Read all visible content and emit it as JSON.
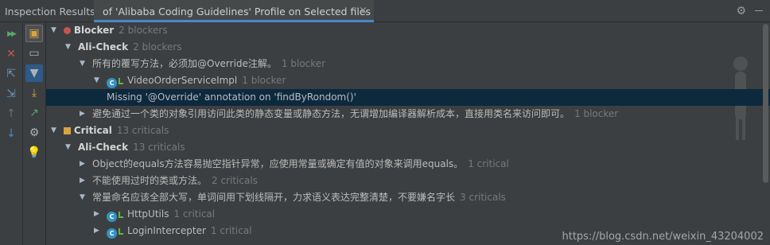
{
  "header": {
    "title": "Inspection Results:",
    "tab_label": "of 'Alibaba Coding Guidelines' Profile on Selected files",
    "close_glyph": "×"
  },
  "toolbar_left": [
    {
      "name": "rerun-icon",
      "glyph": "▶▶",
      "color": "#59a869"
    },
    {
      "name": "close-icon",
      "glyph": "✕",
      "color": "#c75450"
    },
    {
      "name": "expand-all-icon",
      "glyph": "⇱",
      "color": "#6897bb"
    },
    {
      "name": "collapse-all-icon",
      "glyph": "⇲",
      "color": "#6897bb"
    },
    {
      "name": "previous-icon",
      "glyph": "↑",
      "color": "#6e6e6e"
    },
    {
      "name": "next-icon",
      "glyph": "↓",
      "color": "#4a88c7"
    }
  ],
  "toolbar_right": [
    {
      "name": "group-by-severity-icon",
      "glyph": "▣",
      "color": "#d9a343"
    },
    {
      "name": "group-by-directory-icon",
      "glyph": "▭",
      "color": "#afb1b3"
    },
    {
      "name": "filter-icon",
      "glyph": "▼",
      "color": "#afb1b3"
    },
    {
      "name": "export-icon",
      "glyph": "⤓",
      "color": "#d9a343"
    },
    {
      "name": "edit-settings-icon",
      "glyph": "↗",
      "color": "#59a869"
    },
    {
      "name": "quickfix-icon",
      "glyph": "⚙",
      "color": "#afb1b3"
    },
    {
      "name": "lightbulb-icon",
      "glyph": "💡",
      "color": "#e8c046"
    }
  ],
  "tree": [
    {
      "level": 0,
      "arrow": "▼",
      "icon": "blocker",
      "label": "Blocker",
      "bold": true,
      "count": "2 blockers"
    },
    {
      "level": 1,
      "arrow": "▼",
      "icon": "",
      "label": "Ali-Check",
      "bold": true,
      "count": "2 blockers"
    },
    {
      "level": 2,
      "arrow": "▼",
      "icon": "",
      "label": "所有的覆写方法，必须加@Override注解。",
      "bold": false,
      "count": "1 blocker"
    },
    {
      "level": 3,
      "arrow": "▼",
      "icon": "class",
      "label": "VideoOrderServiceImpl",
      "bold": false,
      "count": "1 blocker"
    },
    {
      "level": 4,
      "arrow": "",
      "icon": "",
      "label": "Missing '@Override' annotation on 'findByRondom()'",
      "bold": false,
      "count": "",
      "selected": true
    },
    {
      "level": 2,
      "arrow": "▶",
      "icon": "",
      "label": "避免通过一个类的对象引用访问此类的静态变量或静态方法，无谓增加编译器解析成本，直接用类名来访问即可。",
      "bold": false,
      "count": "1 blocker"
    },
    {
      "level": 0,
      "arrow": "▼",
      "icon": "critical",
      "label": "Critical",
      "bold": true,
      "count": "13 criticals"
    },
    {
      "level": 1,
      "arrow": "▼",
      "icon": "",
      "label": "Ali-Check",
      "bold": true,
      "count": "13 criticals"
    },
    {
      "level": 2,
      "arrow": "▶",
      "icon": "",
      "label": "Object的equals方法容易抛空指针异常，应使用常量或确定有值的对象来调用equals。",
      "bold": false,
      "count": "1 critical"
    },
    {
      "level": 2,
      "arrow": "▶",
      "icon": "",
      "label": "不能使用过时的类或方法。",
      "bold": false,
      "count": "2 criticals"
    },
    {
      "level": 2,
      "arrow": "▼",
      "icon": "",
      "label": "常量命名应该全部大写，单词间用下划线隔开，力求语义表达完整清楚，不要嫌名字长",
      "bold": false,
      "count": "3 criticals"
    },
    {
      "level": 3,
      "arrow": "▶",
      "icon": "class",
      "label": "HttpUtils",
      "bold": false,
      "count": "1 critical"
    },
    {
      "level": 3,
      "arrow": "▶",
      "icon": "class",
      "label": "LoginIntercepter",
      "bold": false,
      "count": "1 critical"
    }
  ],
  "watermark": "https://blog.csdn.net/weixin_43204002"
}
